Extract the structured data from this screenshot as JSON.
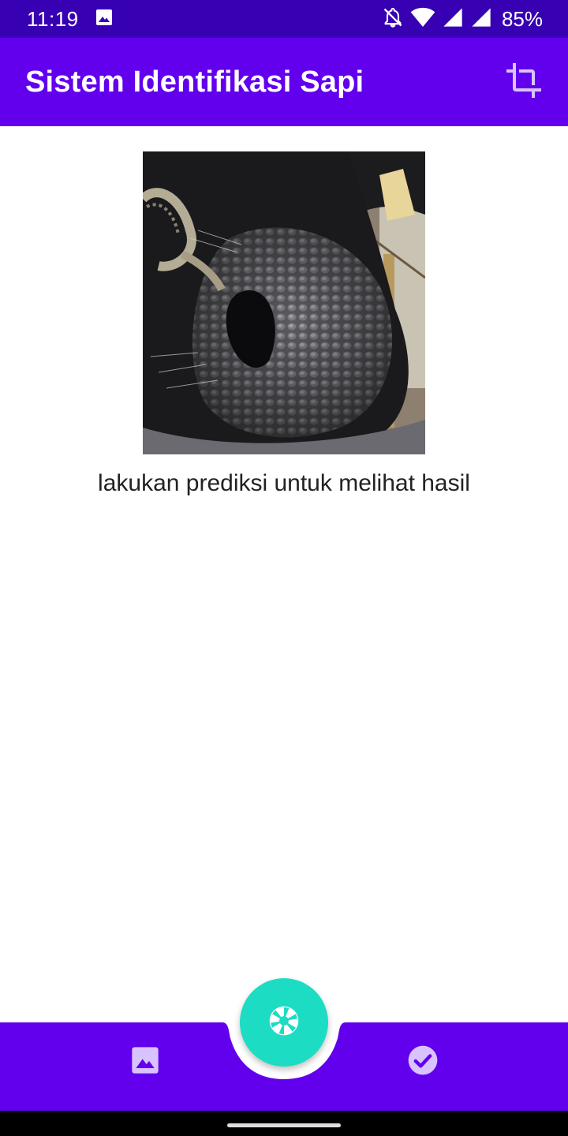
{
  "status_bar": {
    "time": "11:19",
    "battery": "85%",
    "icons": [
      "image-icon",
      "notifications-off-icon",
      "wifi-icon",
      "signal-icon",
      "signal-icon-2"
    ]
  },
  "app_bar": {
    "title": "Sistem Identifikasi Sapi",
    "action_icon": "crop-icon"
  },
  "content": {
    "image_subject": "cow-muzzle-photo",
    "result_text": "lakukan prediksi untuk melihat hasil"
  },
  "bottom_nav": {
    "left_icon": "gallery-icon",
    "center_icon": "camera-shutter-icon",
    "right_icon": "check-circle-icon"
  },
  "colors": {
    "status_bar": "#3700B3",
    "primary": "#6200EE",
    "fab": "#1DDCC4",
    "nav_icon": "#D9C3FF"
  }
}
